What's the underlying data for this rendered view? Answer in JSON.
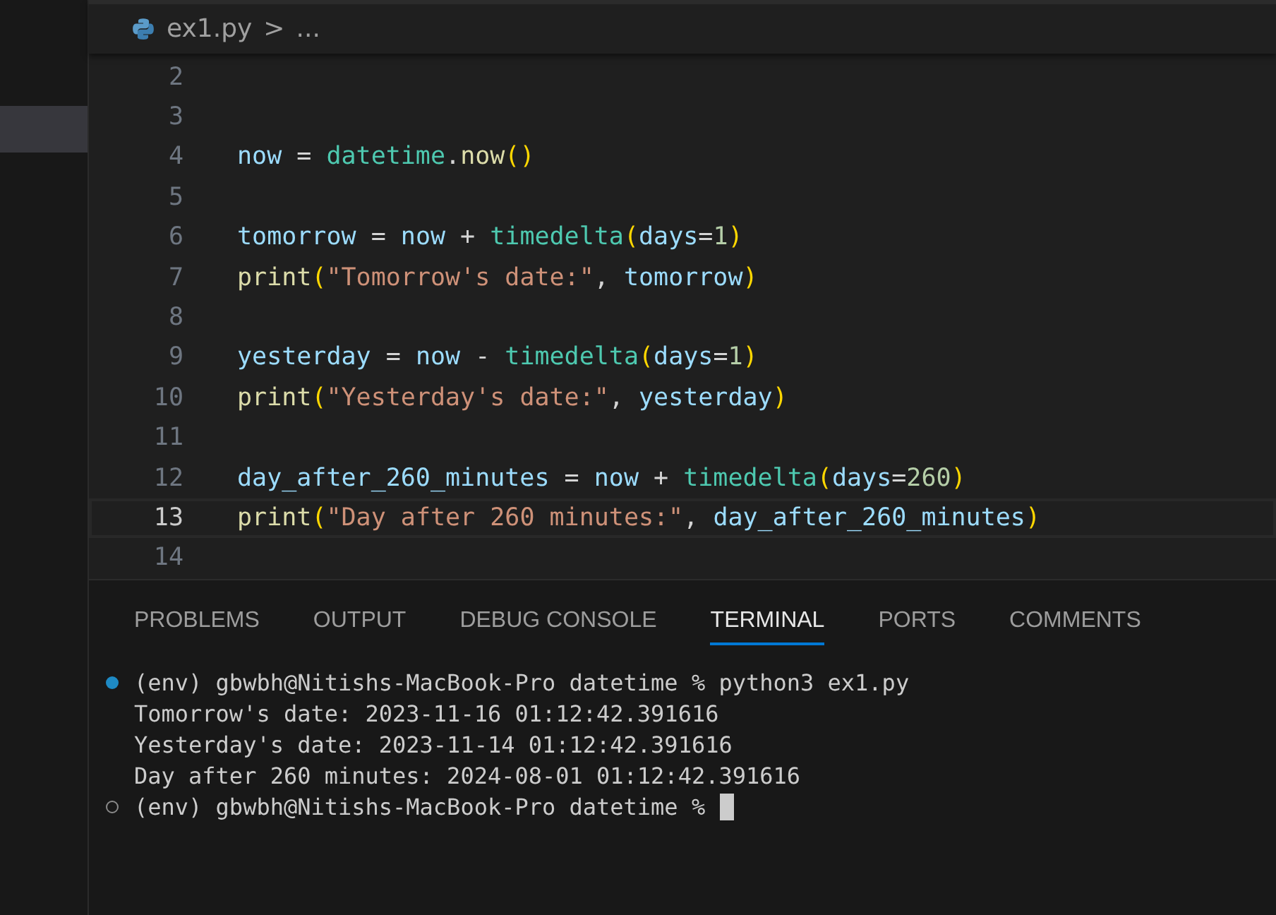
{
  "breadcrumb": {
    "file": "ex1.py",
    "separator": ">",
    "more": "..."
  },
  "editor": {
    "lines": [
      {
        "number": "2",
        "current": false
      },
      {
        "number": "3",
        "current": false
      },
      {
        "number": "4",
        "current": false,
        "tokens": [
          {
            "text": "now",
            "kind": "var"
          },
          {
            "text": " = ",
            "kind": "op"
          },
          {
            "text": "datetime",
            "kind": "cls"
          },
          {
            "text": ".",
            "kind": "op"
          },
          {
            "text": "now",
            "kind": "fn"
          },
          {
            "text": "()",
            "kind": "paren"
          }
        ]
      },
      {
        "number": "5",
        "current": false
      },
      {
        "number": "6",
        "current": false,
        "tokens": [
          {
            "text": "tomorrow",
            "kind": "var"
          },
          {
            "text": " = ",
            "kind": "op"
          },
          {
            "text": "now",
            "kind": "var"
          },
          {
            "text": " + ",
            "kind": "op"
          },
          {
            "text": "timedelta",
            "kind": "cls"
          },
          {
            "text": "(",
            "kind": "paren"
          },
          {
            "text": "days",
            "kind": "var"
          },
          {
            "text": "=",
            "kind": "op"
          },
          {
            "text": "1",
            "kind": "num"
          },
          {
            "text": ")",
            "kind": "paren"
          }
        ]
      },
      {
        "number": "7",
        "current": false,
        "tokens": [
          {
            "text": "print",
            "kind": "fn"
          },
          {
            "text": "(",
            "kind": "paren"
          },
          {
            "text": "\"Tomorrow's date:\"",
            "kind": "str"
          },
          {
            "text": ", ",
            "kind": "op"
          },
          {
            "text": "tomorrow",
            "kind": "var"
          },
          {
            "text": ")",
            "kind": "paren"
          }
        ]
      },
      {
        "number": "8",
        "current": false
      },
      {
        "number": "9",
        "current": false,
        "tokens": [
          {
            "text": "yesterday",
            "kind": "var"
          },
          {
            "text": " = ",
            "kind": "op"
          },
          {
            "text": "now",
            "kind": "var"
          },
          {
            "text": " - ",
            "kind": "op"
          },
          {
            "text": "timedelta",
            "kind": "cls"
          },
          {
            "text": "(",
            "kind": "paren"
          },
          {
            "text": "days",
            "kind": "var"
          },
          {
            "text": "=",
            "kind": "op"
          },
          {
            "text": "1",
            "kind": "num"
          },
          {
            "text": ")",
            "kind": "paren"
          }
        ]
      },
      {
        "number": "10",
        "current": false,
        "tokens": [
          {
            "text": "print",
            "kind": "fn"
          },
          {
            "text": "(",
            "kind": "paren"
          },
          {
            "text": "\"Yesterday's date:\"",
            "kind": "str"
          },
          {
            "text": ", ",
            "kind": "op"
          },
          {
            "text": "yesterday",
            "kind": "var"
          },
          {
            "text": ")",
            "kind": "paren"
          }
        ]
      },
      {
        "number": "11",
        "current": false
      },
      {
        "number": "12",
        "current": false,
        "tokens": [
          {
            "text": "day_after_260_minutes",
            "kind": "var"
          },
          {
            "text": " = ",
            "kind": "op"
          },
          {
            "text": "now",
            "kind": "var"
          },
          {
            "text": " + ",
            "kind": "op"
          },
          {
            "text": "timedelta",
            "kind": "cls"
          },
          {
            "text": "(",
            "kind": "paren"
          },
          {
            "text": "days",
            "kind": "var"
          },
          {
            "text": "=",
            "kind": "op"
          },
          {
            "text": "260",
            "kind": "num"
          },
          {
            "text": ")",
            "kind": "paren"
          }
        ]
      },
      {
        "number": "13",
        "current": true,
        "tokens": [
          {
            "text": "print",
            "kind": "fn"
          },
          {
            "text": "(",
            "kind": "paren"
          },
          {
            "text": "\"Day after 260 minutes:\"",
            "kind": "str"
          },
          {
            "text": ", ",
            "kind": "op"
          },
          {
            "text": "day_after_260_minutes",
            "kind": "var"
          },
          {
            "text": ")",
            "kind": "paren"
          }
        ]
      },
      {
        "number": "14",
        "current": false
      }
    ]
  },
  "panel": {
    "tabs": [
      {
        "label": "PROBLEMS",
        "selected": false
      },
      {
        "label": "OUTPUT",
        "selected": false
      },
      {
        "label": "DEBUG CONSOLE",
        "selected": false
      },
      {
        "label": "TERMINAL",
        "selected": true
      },
      {
        "label": "PORTS",
        "selected": false
      },
      {
        "label": "COMMENTS",
        "selected": false
      }
    ],
    "terminal": [
      {
        "kind": "prompt",
        "completed": true,
        "text": "(env) gbwbh@Nitishs-MacBook-Pro datetime % python3 ex1.py"
      },
      {
        "kind": "output",
        "text": "Tomorrow's date: 2023-11-16 01:12:42.391616"
      },
      {
        "kind": "output",
        "text": "Yesterday's date: 2023-11-14 01:12:42.391616"
      },
      {
        "kind": "output",
        "text": "Day after 260 minutes: 2024-08-01 01:12:42.391616"
      },
      {
        "kind": "prompt",
        "completed": false,
        "text": "(env) gbwbh@Nitishs-MacBook-Pro datetime %",
        "cursor": true
      }
    ]
  }
}
